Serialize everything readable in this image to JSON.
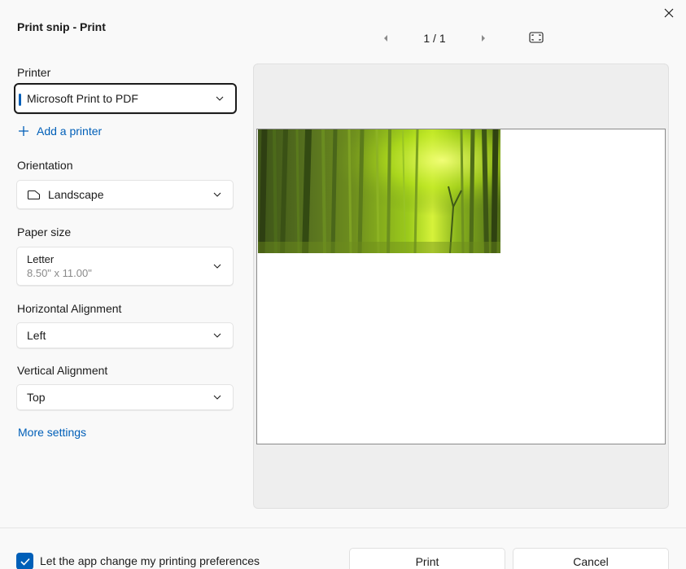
{
  "window": {
    "title": "Print snip - Print",
    "close_icon": "close-icon"
  },
  "pager": {
    "page_indicator": "1 / 1",
    "prev_icon": "triangle-left-icon",
    "next_icon": "triangle-right-icon",
    "fit_icon": "fit-page-icon"
  },
  "settings": {
    "printer": {
      "label": "Printer",
      "value": "Microsoft Print to PDF"
    },
    "add_printer": {
      "label": "Add a printer",
      "icon": "plus-icon"
    },
    "orientation": {
      "label": "Orientation",
      "value": "Landscape",
      "icon": "landscape-page-icon"
    },
    "paper_size": {
      "label": "Paper size",
      "value": "Letter",
      "detail": "8.50\" x 11.00\""
    },
    "horizontal_alignment": {
      "label": "Horizontal Alignment",
      "value": "Left"
    },
    "vertical_alignment": {
      "label": "Vertical Alignment",
      "value": "Top"
    },
    "more_settings": "More settings"
  },
  "footer": {
    "preferences_checkbox": {
      "label": "Let the app change my printing preferences",
      "checked": true
    },
    "print_button": "Print",
    "cancel_button": "Cancel"
  },
  "colors": {
    "accent": "#005fb8",
    "background": "#f9f9f9",
    "preview_background": "#eeeeee"
  }
}
